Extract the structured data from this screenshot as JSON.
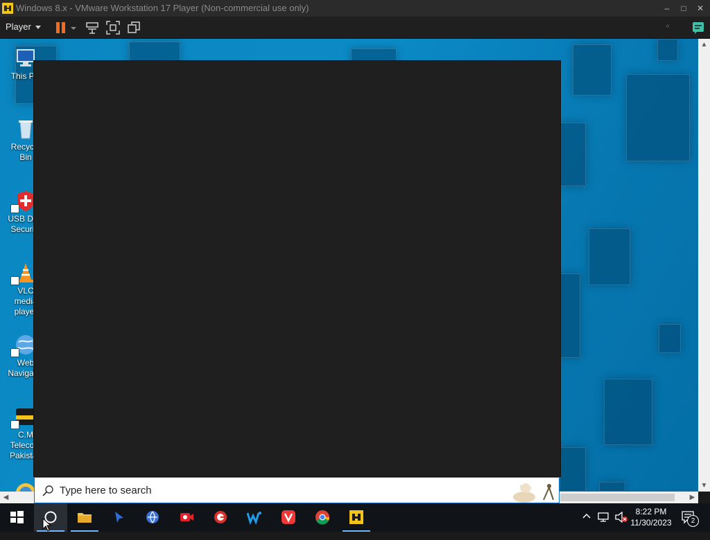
{
  "window": {
    "title": "Windows 8.x - VMware Workstation 17 Player (Non-commercial use only)"
  },
  "toolbar": {
    "player_label": "Player"
  },
  "desktop": {
    "icons": [
      {
        "label": "This PC"
      },
      {
        "label": "Recycle Bin"
      },
      {
        "label": "USB Disk Security"
      },
      {
        "label": "VLC media player"
      },
      {
        "label": "Web Navigator"
      },
      {
        "label": "C.M Telecom Pakistan"
      }
    ]
  },
  "search": {
    "placeholder": "Type here to search"
  },
  "taskbar": {
    "apps": [
      "start-windows-icon",
      "search-circle-icon",
      "file-explorer-icon",
      "cursor-app-icon",
      "network-globe-icon",
      "screen-recorder-icon",
      "browser-g-icon",
      "w-app-icon",
      "vivaldi-icon",
      "chrome-icon",
      "vmware-icon"
    ]
  },
  "tray": {
    "time": "8:22 PM",
    "date": "11/30/2023",
    "notification_count": "2"
  },
  "colors": {
    "desktop_accent": "#0a86c0",
    "overlay_bg": "#1f1f1f",
    "taskbar_bg": "#101317",
    "pause_orange": "#f26b21",
    "vmware_yellow": "#f3c31a"
  }
}
